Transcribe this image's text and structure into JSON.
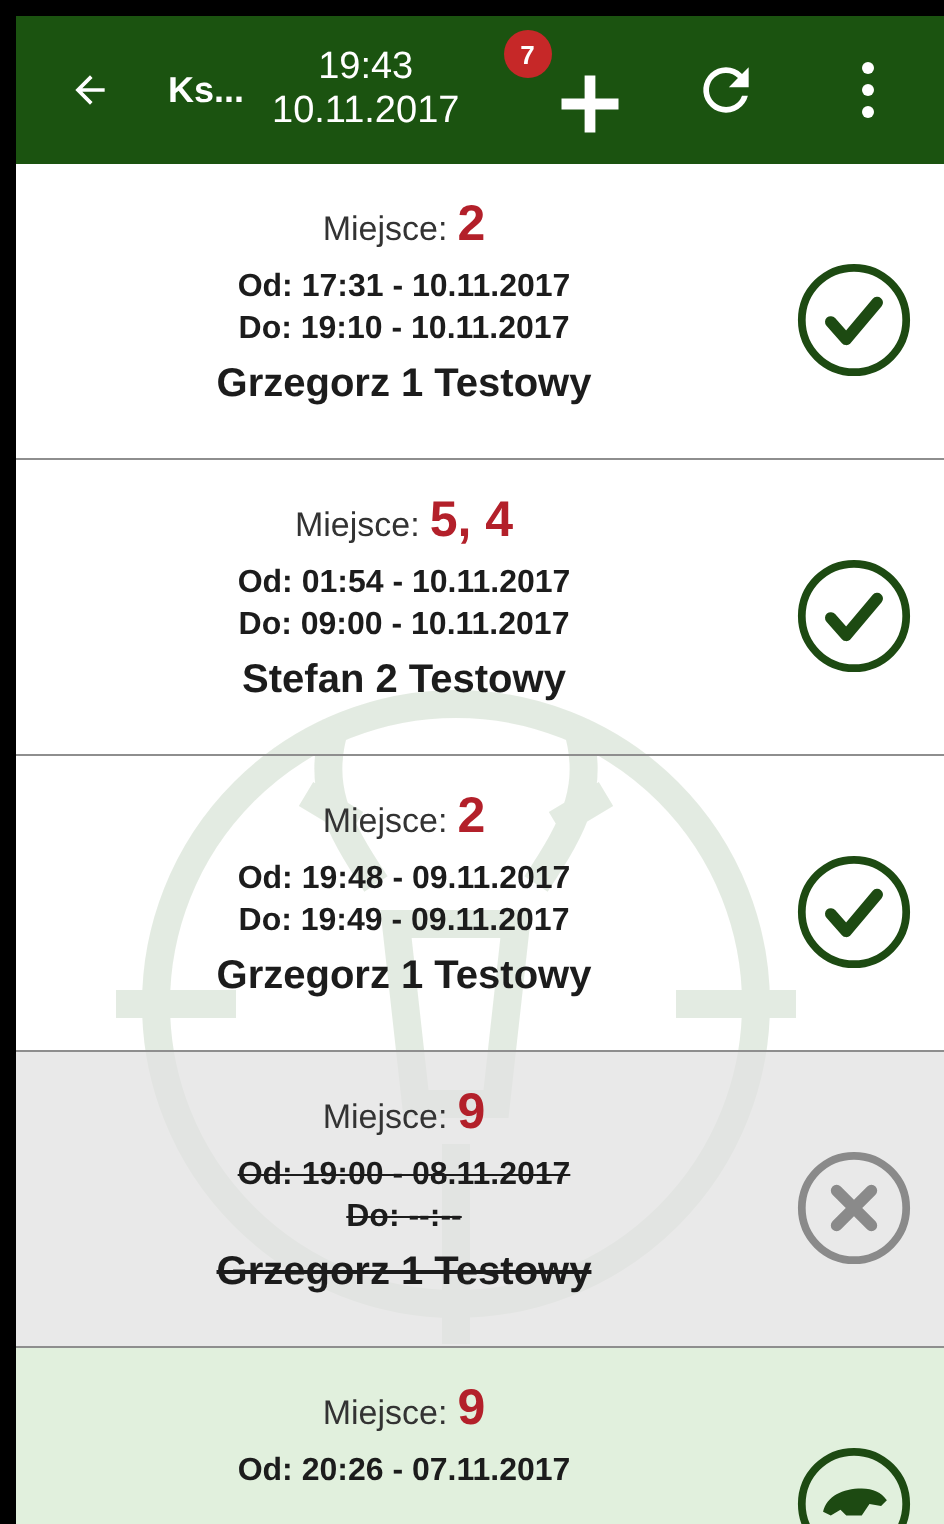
{
  "toolbar": {
    "title": "Ks...",
    "time": "19:43",
    "date": "10.11.2017",
    "badge": "7"
  },
  "entries": [
    {
      "kind": "confirmed",
      "place_label": "Miejsce:",
      "place": "2",
      "from": "Od: 17:31 - 10.11.2017",
      "to": "Do: 19:10 - 10.11.2017",
      "hunter": "Grzegorz 1 Testowy"
    },
    {
      "kind": "confirmed",
      "place_label": "Miejsce:",
      "place": "5, 4",
      "from": "Od: 01:54 - 10.11.2017",
      "to": "Do: 09:00 - 10.11.2017",
      "hunter": "Stefan 2 Testowy"
    },
    {
      "kind": "confirmed",
      "place_label": "Miejsce:",
      "place": "2",
      "from": "Od: 19:48 - 09.11.2017",
      "to": "Do: 19:49 - 09.11.2017",
      "hunter": "Grzegorz 1 Testowy"
    },
    {
      "kind": "cancelled",
      "place_label": "Miejsce:",
      "place": "9",
      "from": "Od: 19:00 - 08.11.2017",
      "to": "Do: --:--",
      "hunter": "Grzegorz 1 Testowy"
    },
    {
      "kind": "active",
      "place_label": "Miejsce:",
      "place": "9",
      "from": "Od: 20:26 - 07.11.2017"
    }
  ]
}
